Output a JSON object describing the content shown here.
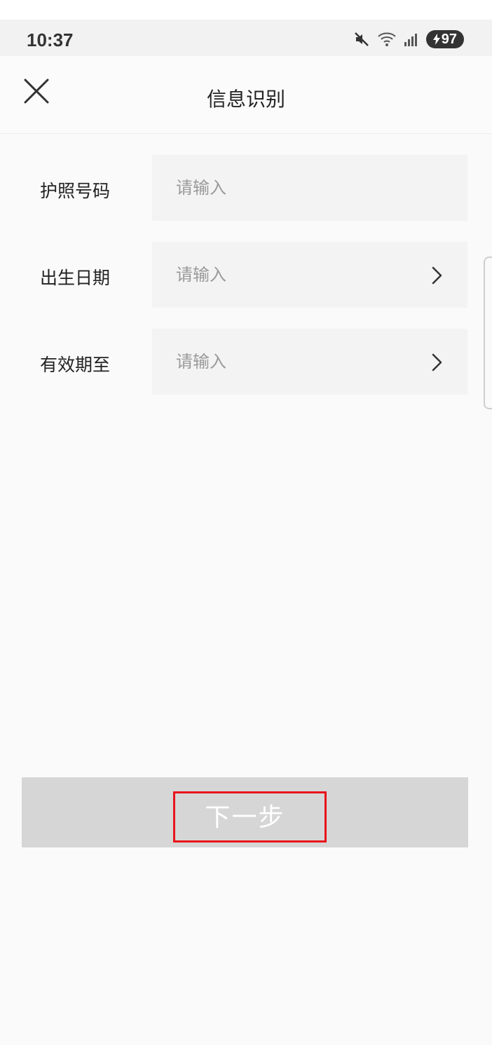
{
  "status_bar": {
    "time": "10:37",
    "battery": "97",
    "icons": [
      "mute-icon",
      "wifi-icon",
      "signal-icon",
      "battery-icon"
    ]
  },
  "header": {
    "title": "信息识别",
    "close_icon": "close-icon"
  },
  "form": {
    "fields": [
      {
        "label": "护照号码",
        "placeholder": "请输入",
        "has_chevron": false
      },
      {
        "label": "出生日期",
        "placeholder": "请输入",
        "has_chevron": true
      },
      {
        "label": "有效期至",
        "placeholder": "请输入",
        "has_chevron": true
      }
    ]
  },
  "actions": {
    "next_label": "下一步"
  },
  "colors": {
    "button_disabled_bg": "#d6d6d6",
    "highlight": "#e8141b",
    "field_bg": "#f3f3f3"
  }
}
